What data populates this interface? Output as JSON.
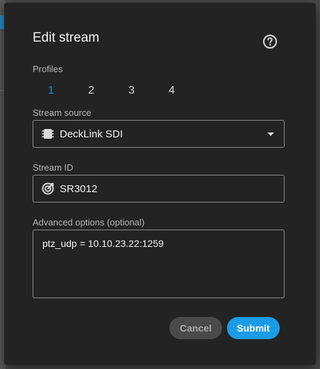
{
  "dialog": {
    "title": "Edit stream",
    "help_icon": "question-circle-icon"
  },
  "profiles": {
    "label": "Profiles",
    "tabs": [
      {
        "label": "1",
        "active": true
      },
      {
        "label": "2",
        "active": false
      },
      {
        "label": "3",
        "active": false
      },
      {
        "label": "4",
        "active": false
      }
    ],
    "active_color": "#1e88d0"
  },
  "stream_source": {
    "label": "Stream source",
    "value": "DeckLink SDI",
    "icon": "sdi-card-icon"
  },
  "stream_id": {
    "label": "Stream ID",
    "value": "SR3012",
    "icon": "target-check-icon"
  },
  "advanced": {
    "label": "Advanced options (optional)",
    "value": "ptz_udp = 10.10.23.22:1259"
  },
  "buttons": {
    "cancel_label": "Cancel",
    "submit_label": "Submit",
    "submit_color": "#1b9be6"
  }
}
